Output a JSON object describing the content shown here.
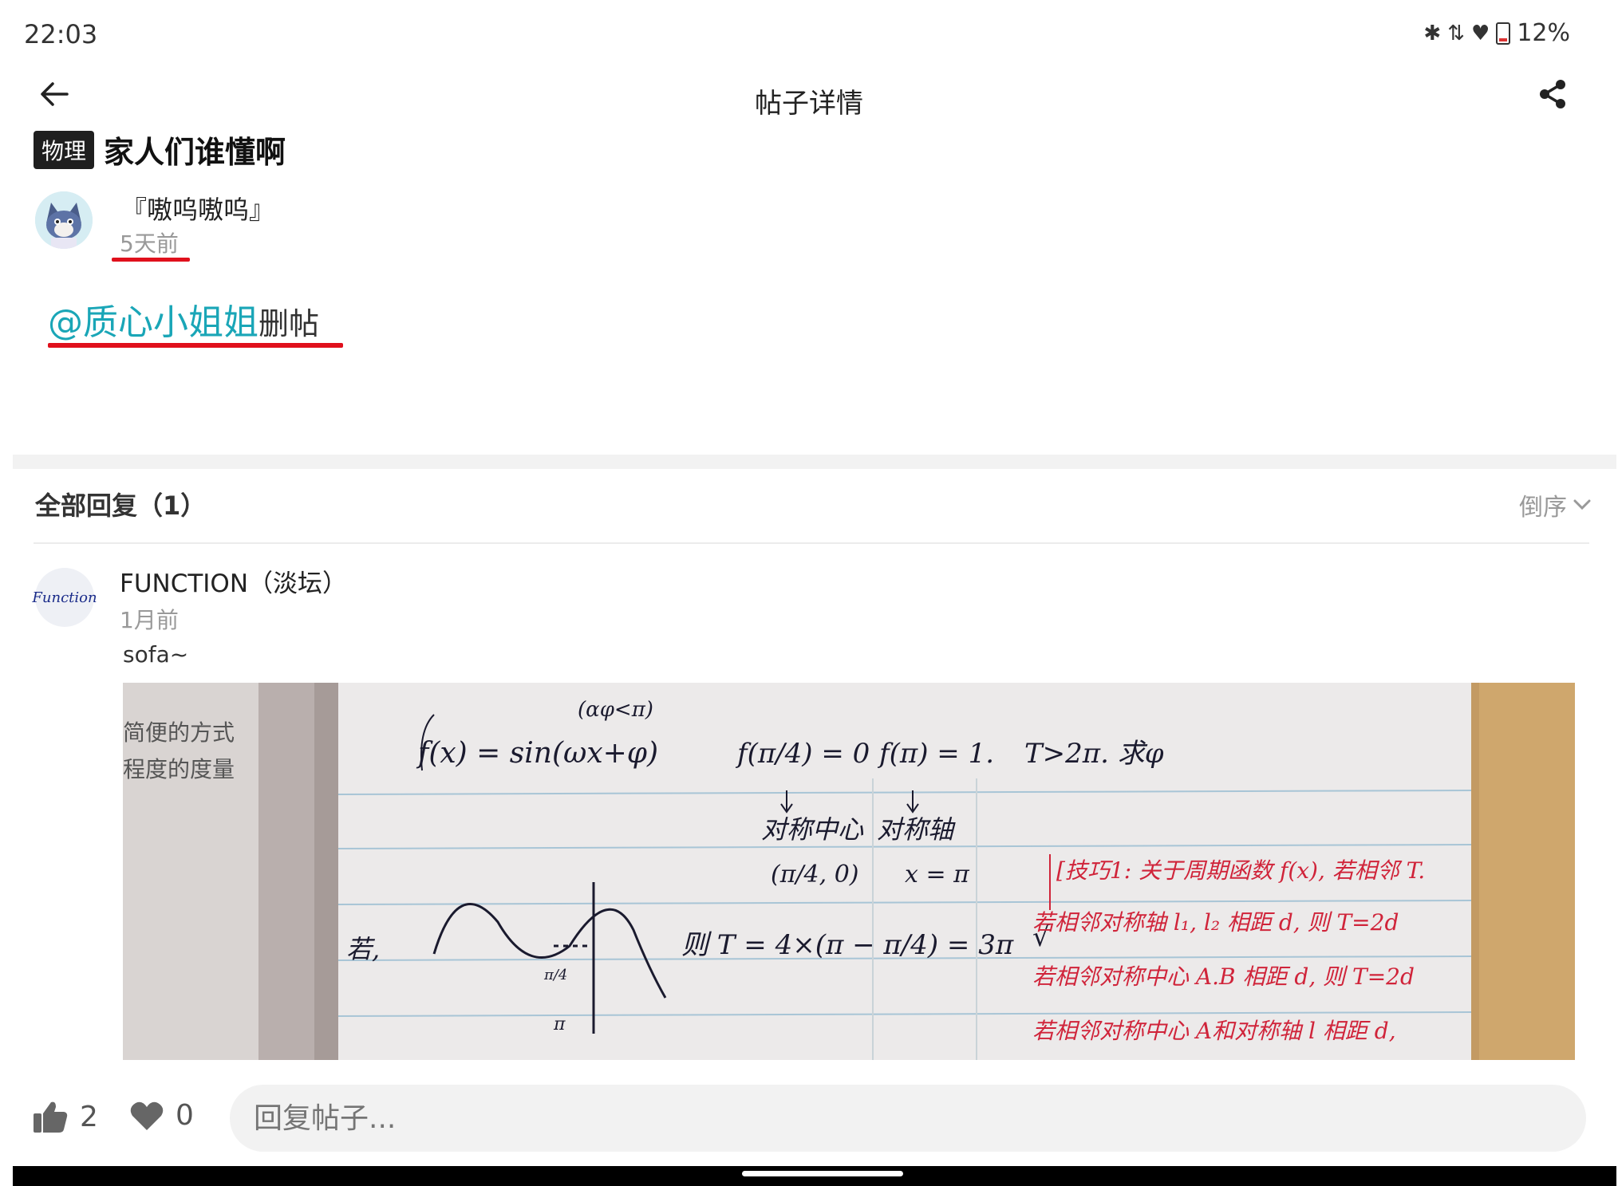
{
  "status_bar": {
    "time": "22:03",
    "battery": "12%",
    "icons": [
      "bluetooth-icon",
      "data-arrows-icon",
      "wifi-icon",
      "battery-icon"
    ]
  },
  "topbar": {
    "title": "帖子详情",
    "back_icon": "arrow-left-icon",
    "share_icon": "share-icon"
  },
  "post": {
    "tag": "物理",
    "title": "家人们谁懂啊",
    "author": "『嗷呜嗷呜』",
    "time": "5天前",
    "mention": "@质心小姐姐",
    "body_rest": "删帖"
  },
  "replies": {
    "header": "全部回复（1）",
    "sort_label": "倒序",
    "items": [
      {
        "author": "FUNCTION（淡坛）",
        "avatar_text": "Function",
        "time": "1月前",
        "text": "sofa~",
        "image": {
          "lines": [
            "f(x) = sin(ωx+φ)",
            "f(π/4) = 0",
            "f(π) = 1.",
            "T>2π. 求φ",
            "对称中心",
            "(π/4, 0)",
            "对称轴",
            "x = π",
            "若,",
            "则 T = 4×(π − π/4) = 3π",
            "[技巧1: 关于周期函数 f(x), 若相邻 T.",
            "若相邻对称轴 l₁, l₂ 相距 d, 则 T=2d",
            "若相邻对称中心 A.B 相距 d, 则 T=2d",
            "若相邻对称中心 A和对称轴 l 相距 d,",
            "(αφ<π)",
            "√",
            "π/4",
            "π",
            "简便的方式",
            "程度的度量"
          ]
        }
      }
    ]
  },
  "bottom_bar": {
    "like_count": "2",
    "favorite_count": "0",
    "reply_placeholder": "回复帖子..."
  },
  "colors": {
    "mention": "#1aa6b7",
    "annotation_red": "#e0101c",
    "tag_bg": "#1f1f1f"
  }
}
